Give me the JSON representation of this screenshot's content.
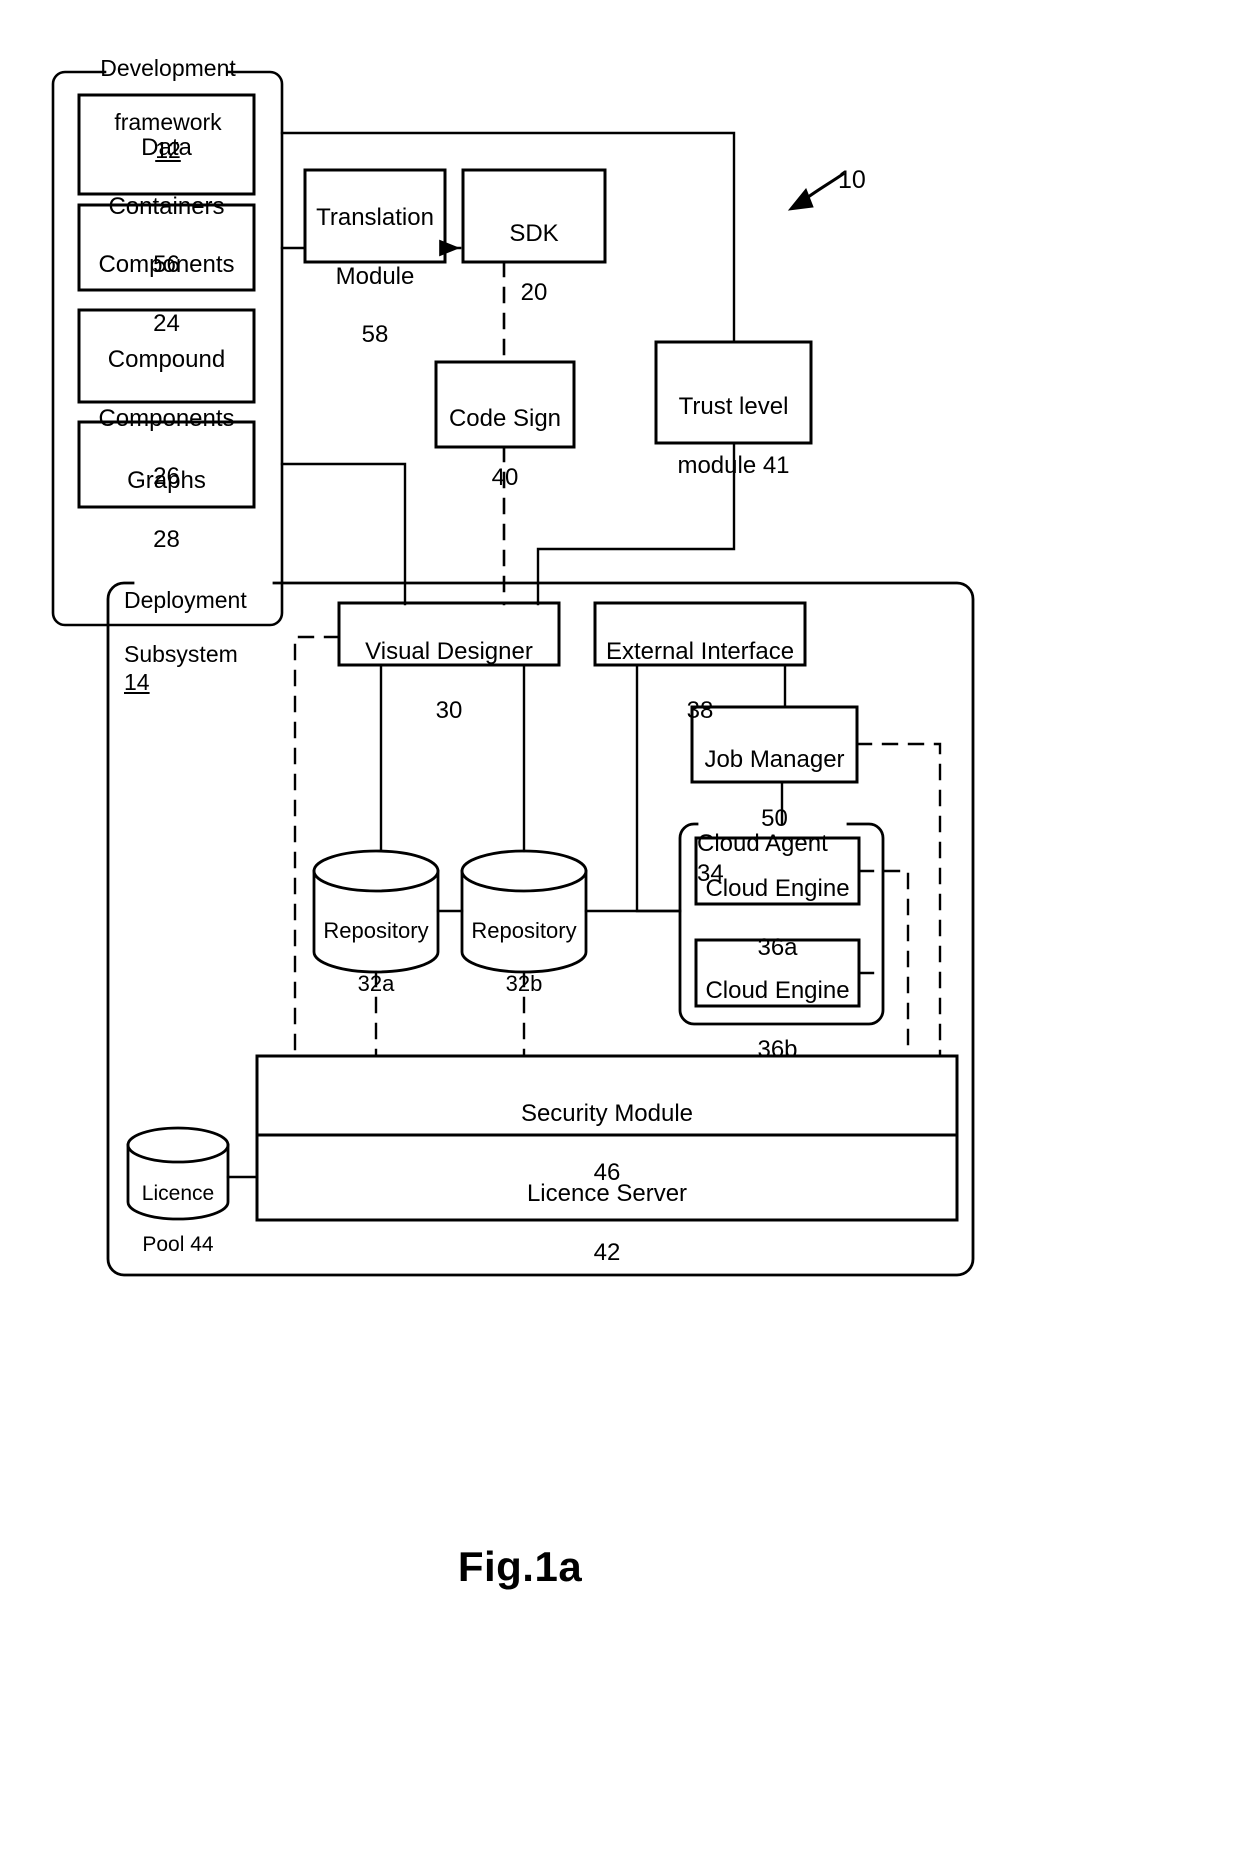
{
  "figure": {
    "caption": "Fig.1a",
    "system_ref": "10"
  },
  "development_framework": {
    "title_line1": "Development",
    "title_line2": "framework",
    "ref": "12",
    "items": [
      {
        "name": "Data Containers",
        "line1": "Data",
        "line2": "Containers",
        "ref": "56"
      },
      {
        "name": "Components",
        "line1": "Components",
        "line2": "",
        "ref": "24"
      },
      {
        "name": "Compound Components",
        "line1": "Compound",
        "line2": "Components",
        "ref": "26"
      },
      {
        "name": "Graphs",
        "line1": "Graphs",
        "line2": "",
        "ref": "28"
      }
    ]
  },
  "top_modules": [
    {
      "key": "translation_module",
      "line1": "Translation",
      "line2": "Module",
      "ref": "58"
    },
    {
      "key": "sdk",
      "line1": "SDK",
      "line2": "",
      "ref": "20"
    },
    {
      "key": "code_sign",
      "line1": "Code Sign",
      "line2": "",
      "ref": "40"
    },
    {
      "key": "trust_level_module",
      "line1": "Trust level",
      "line2": "module 41",
      "ref": "41"
    }
  ],
  "deployment_subsystem": {
    "title_line1": "Deployment",
    "title_line2": "Subsystem",
    "ref": "14",
    "visual_designer": {
      "label": "Visual Designer",
      "ref": "30"
    },
    "external_interface": {
      "label": "External Interface",
      "ref": "38"
    },
    "job_manager": {
      "label": "Job Manager",
      "ref": "50"
    },
    "cloud_agent": {
      "label": "Cloud Agent",
      "ref": "34"
    },
    "cloud_engines": [
      {
        "label": "Cloud Engine",
        "ref": "36a"
      },
      {
        "label": "Cloud Engine",
        "ref": "36b"
      }
    ],
    "repositories": [
      {
        "label": "Repository",
        "ref": "32a"
      },
      {
        "label": "Repository",
        "ref": "32b"
      }
    ],
    "security_module": {
      "label": "Security Module",
      "ref": "46"
    },
    "licence_server": {
      "label": "Licence Server",
      "ref": "42"
    },
    "licence_pool": {
      "line1": "Licence",
      "line2": "Pool 44",
      "ref": "44"
    }
  },
  "colors": {
    "stroke": "#000000",
    "background": "#ffffff"
  }
}
